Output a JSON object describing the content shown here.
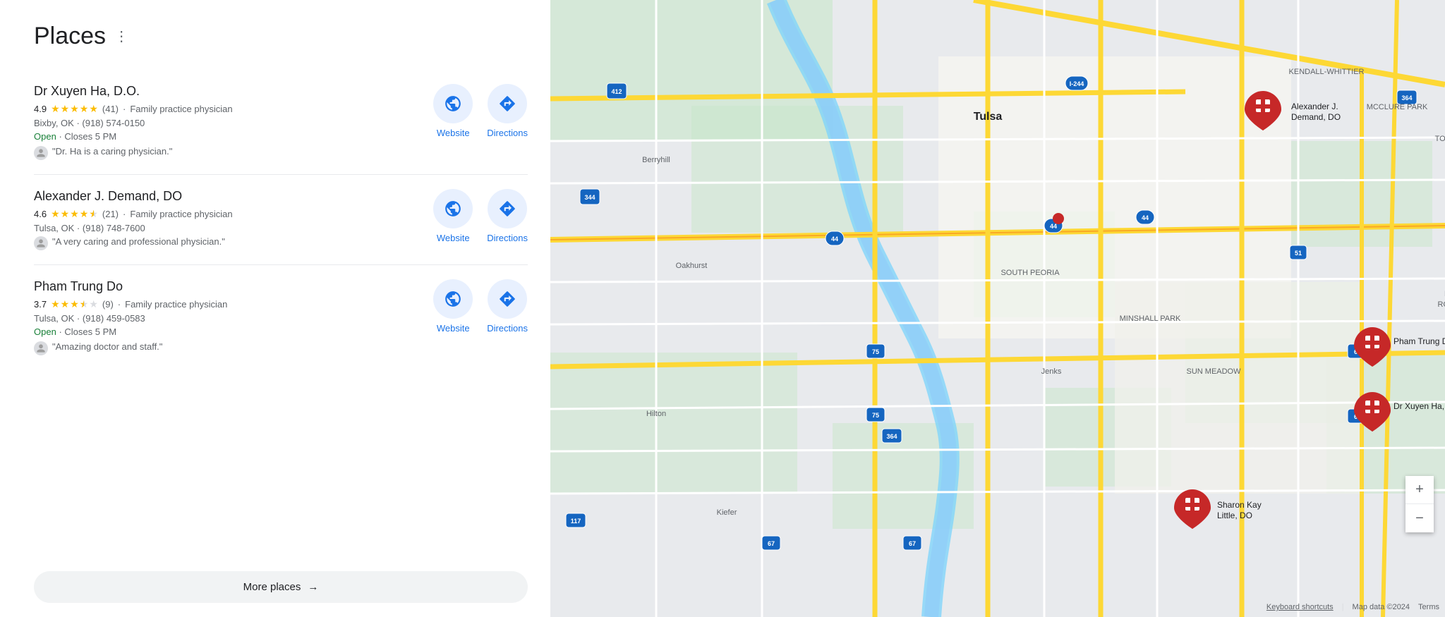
{
  "header": {
    "title": "Places",
    "more_options_label": "⋮"
  },
  "places": [
    {
      "id": 1,
      "name": "Dr Xuyen Ha, D.O.",
      "rating": 4.9,
      "rating_count": 41,
      "stars_full": 5,
      "stars_half": 0,
      "stars_empty": 0,
      "category": "Family practice physician",
      "address": "Bixby, OK · (918) 574-0150",
      "status": "Open",
      "hours": "Closes 5 PM",
      "review": "\"Dr. Ha is a caring physician.\"",
      "has_website": true,
      "has_directions": true
    },
    {
      "id": 2,
      "name": "Alexander J. Demand, DO",
      "rating": 4.6,
      "rating_count": 21,
      "stars_full": 4,
      "stars_half": 1,
      "stars_empty": 0,
      "category": "Family practice physician",
      "address": "Tulsa, OK · (918) 748-7600",
      "status": null,
      "hours": null,
      "review": "\"A very caring and professional physician.\"",
      "has_website": true,
      "has_directions": true
    },
    {
      "id": 3,
      "name": "Pham Trung Do",
      "rating": 3.7,
      "rating_count": 9,
      "stars_full": 3,
      "stars_half": 1,
      "stars_empty": 1,
      "category": "Family practice physician",
      "address": "Tulsa, OK · (918) 459-0583",
      "status": "Open",
      "hours": "Closes 5 PM",
      "review": "\"Amazing doctor and staff.\"",
      "has_website": true,
      "has_directions": true
    }
  ],
  "more_places": {
    "label": "More places",
    "arrow": "→"
  },
  "map": {
    "zoom_in": "+",
    "zoom_out": "−",
    "footer_keyboard": "Keyboard shortcuts",
    "footer_data": "Map data ©2024",
    "footer_terms": "Terms"
  },
  "buttons": {
    "website_label": "Website",
    "directions_label": "Directions"
  }
}
